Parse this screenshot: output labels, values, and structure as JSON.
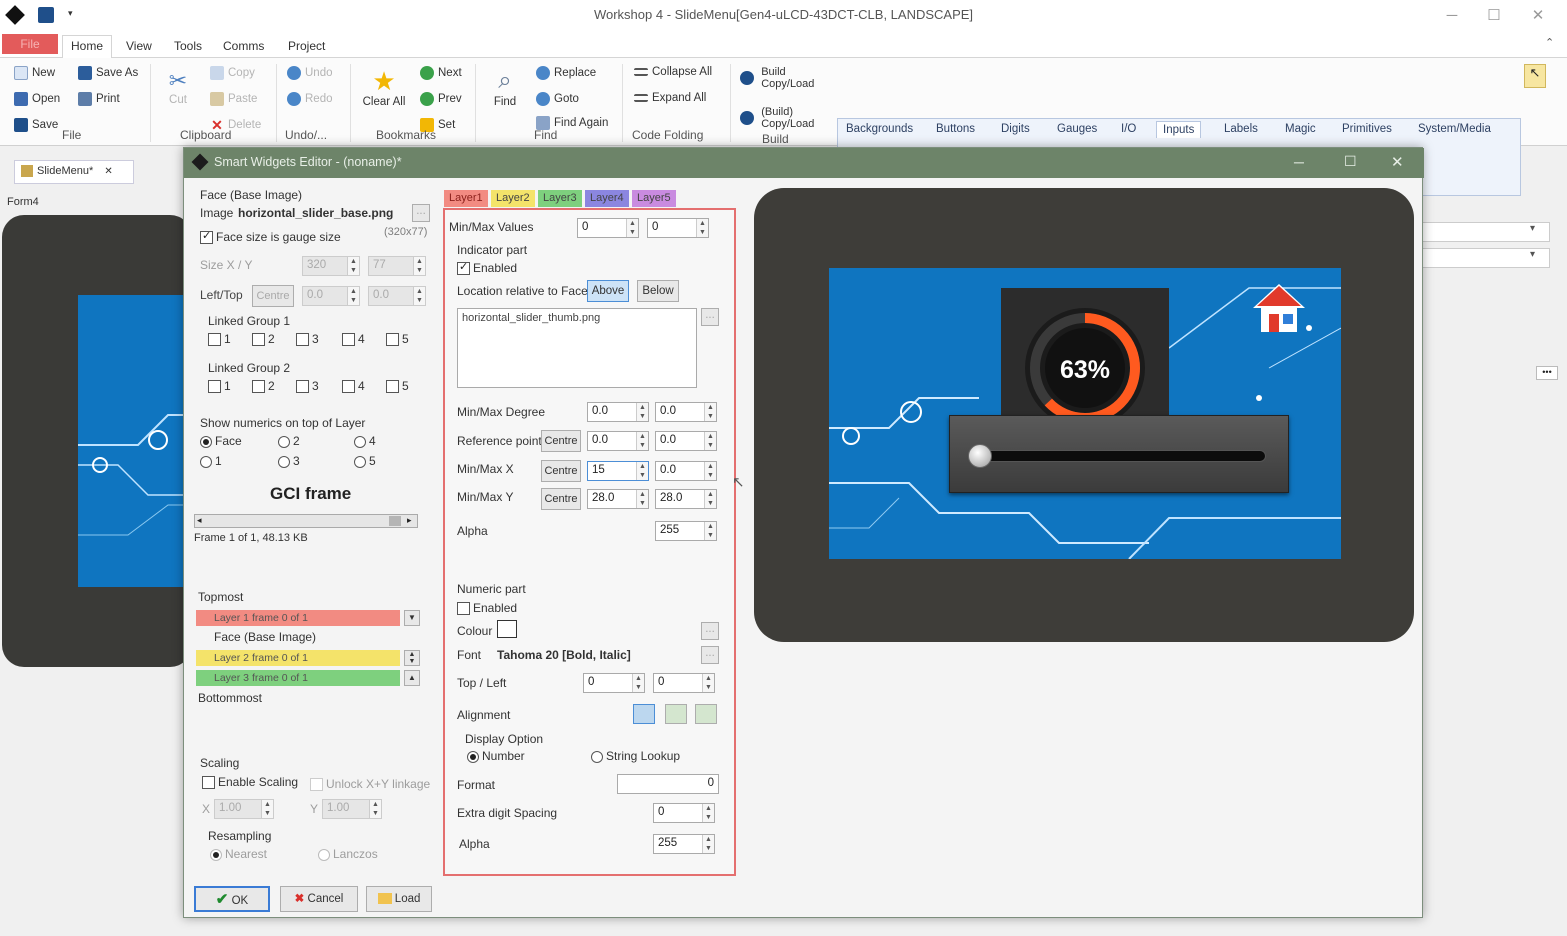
{
  "window": {
    "title": "Workshop 4 - SlideMenu[Gen4-uLCD-43DCT-CLB, LANDSCAPE]",
    "ribbon_tabs": [
      "File",
      "Home",
      "View",
      "Tools",
      "Comms",
      "Project"
    ],
    "active_tab": "Home"
  },
  "ribbon": {
    "file": {
      "new": "New",
      "save_as": "Save As",
      "open": "Open",
      "print": "Print",
      "save": "Save",
      "group": "File"
    },
    "clipboard": {
      "cut": "Cut",
      "copy": "Copy",
      "paste": "Paste",
      "delete": "Delete",
      "group": "Clipboard"
    },
    "undo": {
      "undo": "Undo",
      "redo": "Redo",
      "group": "Undo/..."
    },
    "bookmarks": {
      "clear_all": "Clear All",
      "next": "Next",
      "prev": "Prev",
      "set": "Set",
      "group": "Bookmarks"
    },
    "find": {
      "find": "Find",
      "replace": "Replace",
      "goto": "Goto",
      "find_again": "Find Again",
      "group": "Find"
    },
    "code_folding": {
      "collapse_all": "Collapse All",
      "expand_all": "Expand All",
      "group": "Code Folding"
    },
    "build": {
      "build_copy_load": "Build Copy/Load",
      "build_copy_load2": "(Build) Copy/Load",
      "group": "Build"
    }
  },
  "palette": {
    "tabs": [
      "Backgrounds",
      "Buttons",
      "Digits",
      "Gauges",
      "I/O",
      "Inputs",
      "Labels",
      "Magic",
      "Primitives",
      "System/Media"
    ],
    "active_tab": "Inputs",
    "widgets": [
      "knob-widget",
      "rotary-widget",
      "slider-v-widget",
      "trackbar-widget",
      "keyboard-widget",
      "slider-green-widget",
      "switch-orange-widget",
      "color-picker-widget",
      "joystick-widget",
      "eye-widget"
    ]
  },
  "document": {
    "tab": "SlideMenu*",
    "form": "Form4"
  },
  "dialog": {
    "title": "Smart Widgets Editor - (noname)*",
    "left": {
      "face_heading": "Face (Base Image)",
      "image_label": "Image",
      "image_name": "horizontal_slider_base.png",
      "browse": "...",
      "face_size_label": "Face size is gauge size",
      "face_dims": "(320x77)",
      "size_label": "Size X / Y",
      "size_x": "320",
      "size_y": "77",
      "lefttop_label": "Left/Top",
      "centre": "Centre",
      "left_val": "0.0",
      "top_val": "0.0",
      "linked1": "Linked Group 1",
      "linked2": "Linked Group 2",
      "link_nums": [
        "1",
        "2",
        "3",
        "4",
        "5"
      ],
      "show_numerics": "Show numerics on top of Layer",
      "radio_face": "Face",
      "radio_1": "1",
      "radio_2": "2",
      "radio_3": "3",
      "radio_4": "4",
      "radio_5": "5",
      "gci_frame": "GCI frame",
      "frame_info": "Frame 1 of 1, 48.13 KB",
      "topmost": "Topmost",
      "layer1": "Layer 1 frame 0 of 1",
      "face_base": "Face (Base Image)",
      "layer2": "Layer 2 frame 0 of 1",
      "layer3": "Layer 3 frame 0 of 1",
      "bottommost": "Bottommost",
      "scaling": "Scaling",
      "enable_scaling": "Enable Scaling",
      "unlock_xy": "Unlock X+Y linkage",
      "x_label": "X",
      "scale_x": "1.00",
      "y_label": "Y",
      "scale_y": "1.00",
      "resampling": "Resampling",
      "nearest": "Nearest",
      "lanczos": "Lanczos"
    },
    "layer_tabs": [
      {
        "label": "Layer1",
        "color": "#f28b82"
      },
      {
        "label": "Layer2",
        "color": "#f4e36a"
      },
      {
        "label": "Layer3",
        "color": "#7ed07e"
      },
      {
        "label": "Layer4",
        "color": "#8b86e0"
      },
      {
        "label": "Layer5",
        "color": "#c98be0"
      }
    ],
    "layer": {
      "minmax_values": "Min/Max Values",
      "min_val": "0",
      "max_val": "0",
      "indicator_part": "Indicator part",
      "enabled": "Enabled",
      "location_relative": "Location relative to Face",
      "above": "Above",
      "below": "Below",
      "thumb_file": "horizontal_slider_thumb.png",
      "browse": "...",
      "minmax_degree": "Min/Max Degree",
      "deg_min": "0.0",
      "deg_max": "0.0",
      "reference_point": "Reference point",
      "centre": "Centre",
      "ref_x": "0.0",
      "ref_y": "0.0",
      "minmax_x": "Min/Max X",
      "x_min": "15",
      "x_max": "0.0",
      "minmax_y": "Min/Max Y",
      "y_min": "28.0",
      "y_max": "28.0",
      "alpha": "Alpha",
      "alpha_val": "255",
      "numeric_part": "Numeric part",
      "num_enabled": "Enabled",
      "colour": "Colour",
      "font_label": "Font",
      "font_value": "Tahoma 20 [Bold, Italic]",
      "topleft": "Top / Left",
      "top_val": "0",
      "left_val": "0",
      "alignment": "Alignment",
      "display_option": "Display Option",
      "number": "Number",
      "string_lookup": "String Lookup",
      "format": "Format",
      "format_val": "0",
      "extra_digit": "Extra digit Spacing",
      "extra_val": "0",
      "alpha2": "Alpha",
      "alpha2_val": "255"
    },
    "preview": {
      "percent": "63%",
      "progress": 0.63
    },
    "buttons": {
      "ok": "OK",
      "cancel": "Cancel",
      "load": "Load"
    }
  }
}
